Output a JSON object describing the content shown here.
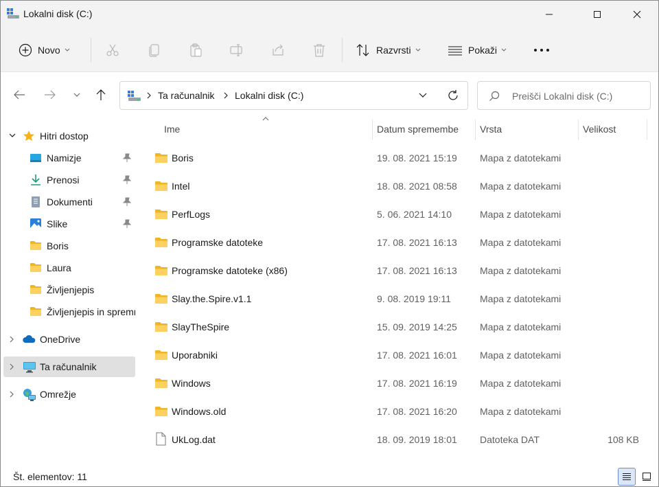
{
  "window": {
    "title": "Lokalni disk (C:)",
    "controls": [
      "minimize",
      "maximize",
      "close"
    ]
  },
  "toolbar": {
    "new_label": "Novo",
    "sort_label": "Razvrsti",
    "view_label": "Pokaži",
    "actions": [
      "cut",
      "copy",
      "paste",
      "rename",
      "share",
      "delete"
    ]
  },
  "address": {
    "crumbs": [
      "Ta računalnik",
      "Lokalni disk (C:)"
    ]
  },
  "search": {
    "placeholder": "Preišči Lokalni disk (C:)"
  },
  "sidebar": {
    "items": [
      {
        "label": "Hitri dostop",
        "icon": "star-icon",
        "expanded": true,
        "indent": 0
      },
      {
        "label": "Namizje",
        "icon": "desktop-icon",
        "pinned": true,
        "indent": 1
      },
      {
        "label": "Prenosi",
        "icon": "download-icon",
        "pinned": true,
        "indent": 1
      },
      {
        "label": "Dokumenti",
        "icon": "document-icon",
        "pinned": true,
        "indent": 1
      },
      {
        "label": "Slike",
        "icon": "pictures-icon",
        "pinned": true,
        "indent": 1
      },
      {
        "label": "Boris",
        "icon": "folder-icon",
        "indent": 1
      },
      {
        "label": "Laura",
        "icon": "folder-icon",
        "indent": 1
      },
      {
        "label": "Življenjepis",
        "icon": "folder-icon",
        "indent": 1
      },
      {
        "label": "Življenjepis in spremno",
        "icon": "folder-icon",
        "indent": 1
      },
      {
        "label": "OneDrive",
        "icon": "cloud-icon",
        "expanded": false,
        "indent": 0
      },
      {
        "label": "Ta računalnik",
        "icon": "computer-icon",
        "expanded": false,
        "selected": true,
        "indent": 0
      },
      {
        "label": "Omrežje",
        "icon": "network-icon",
        "expanded": false,
        "indent": 0
      }
    ]
  },
  "columns": {
    "name": "Ime",
    "date": "Datum spremembe",
    "type": "Vrsta",
    "size": "Velikost"
  },
  "files": [
    {
      "name": "Boris",
      "date": "19. 08. 2021 15:19",
      "type": "Mapa z datotekami",
      "size": "",
      "icon": "folder-icon"
    },
    {
      "name": "Intel",
      "date": "18. 08. 2021 08:58",
      "type": "Mapa z datotekami",
      "size": "",
      "icon": "folder-icon"
    },
    {
      "name": "PerfLogs",
      "date": "5. 06. 2021 14:10",
      "type": "Mapa z datotekami",
      "size": "",
      "icon": "folder-icon"
    },
    {
      "name": "Programske datoteke",
      "date": "17. 08. 2021 16:13",
      "type": "Mapa z datotekami",
      "size": "",
      "icon": "folder-icon"
    },
    {
      "name": "Programske datoteke (x86)",
      "date": "17. 08. 2021 16:13",
      "type": "Mapa z datotekami",
      "size": "",
      "icon": "folder-icon"
    },
    {
      "name": "Slay.the.Spire.v1.1",
      "date": "9. 08. 2019 19:11",
      "type": "Mapa z datotekami",
      "size": "",
      "icon": "folder-icon"
    },
    {
      "name": "SlayTheSpire",
      "date": "15. 09. 2019 14:25",
      "type": "Mapa z datotekami",
      "size": "",
      "icon": "folder-icon"
    },
    {
      "name": "Uporabniki",
      "date": "17. 08. 2021 16:01",
      "type": "Mapa z datotekami",
      "size": "",
      "icon": "folder-icon"
    },
    {
      "name": "Windows",
      "date": "17. 08. 2021 16:19",
      "type": "Mapa z datotekami",
      "size": "",
      "icon": "folder-icon"
    },
    {
      "name": "Windows.old",
      "date": "17. 08. 2021 16:20",
      "type": "Mapa z datotekami",
      "size": "",
      "icon": "folder-icon"
    },
    {
      "name": "UkLog.dat",
      "date": "18. 09. 2019 18:01",
      "type": "Datoteka DAT",
      "size": "108 KB",
      "icon": "file-icon"
    }
  ],
  "status": {
    "item_count": "Št. elementov: 11"
  },
  "colors": {
    "chrome": "#f3f3f3",
    "folder": "#f8c74b",
    "selection": "#e0e0e0",
    "accent": "#0067c0"
  }
}
